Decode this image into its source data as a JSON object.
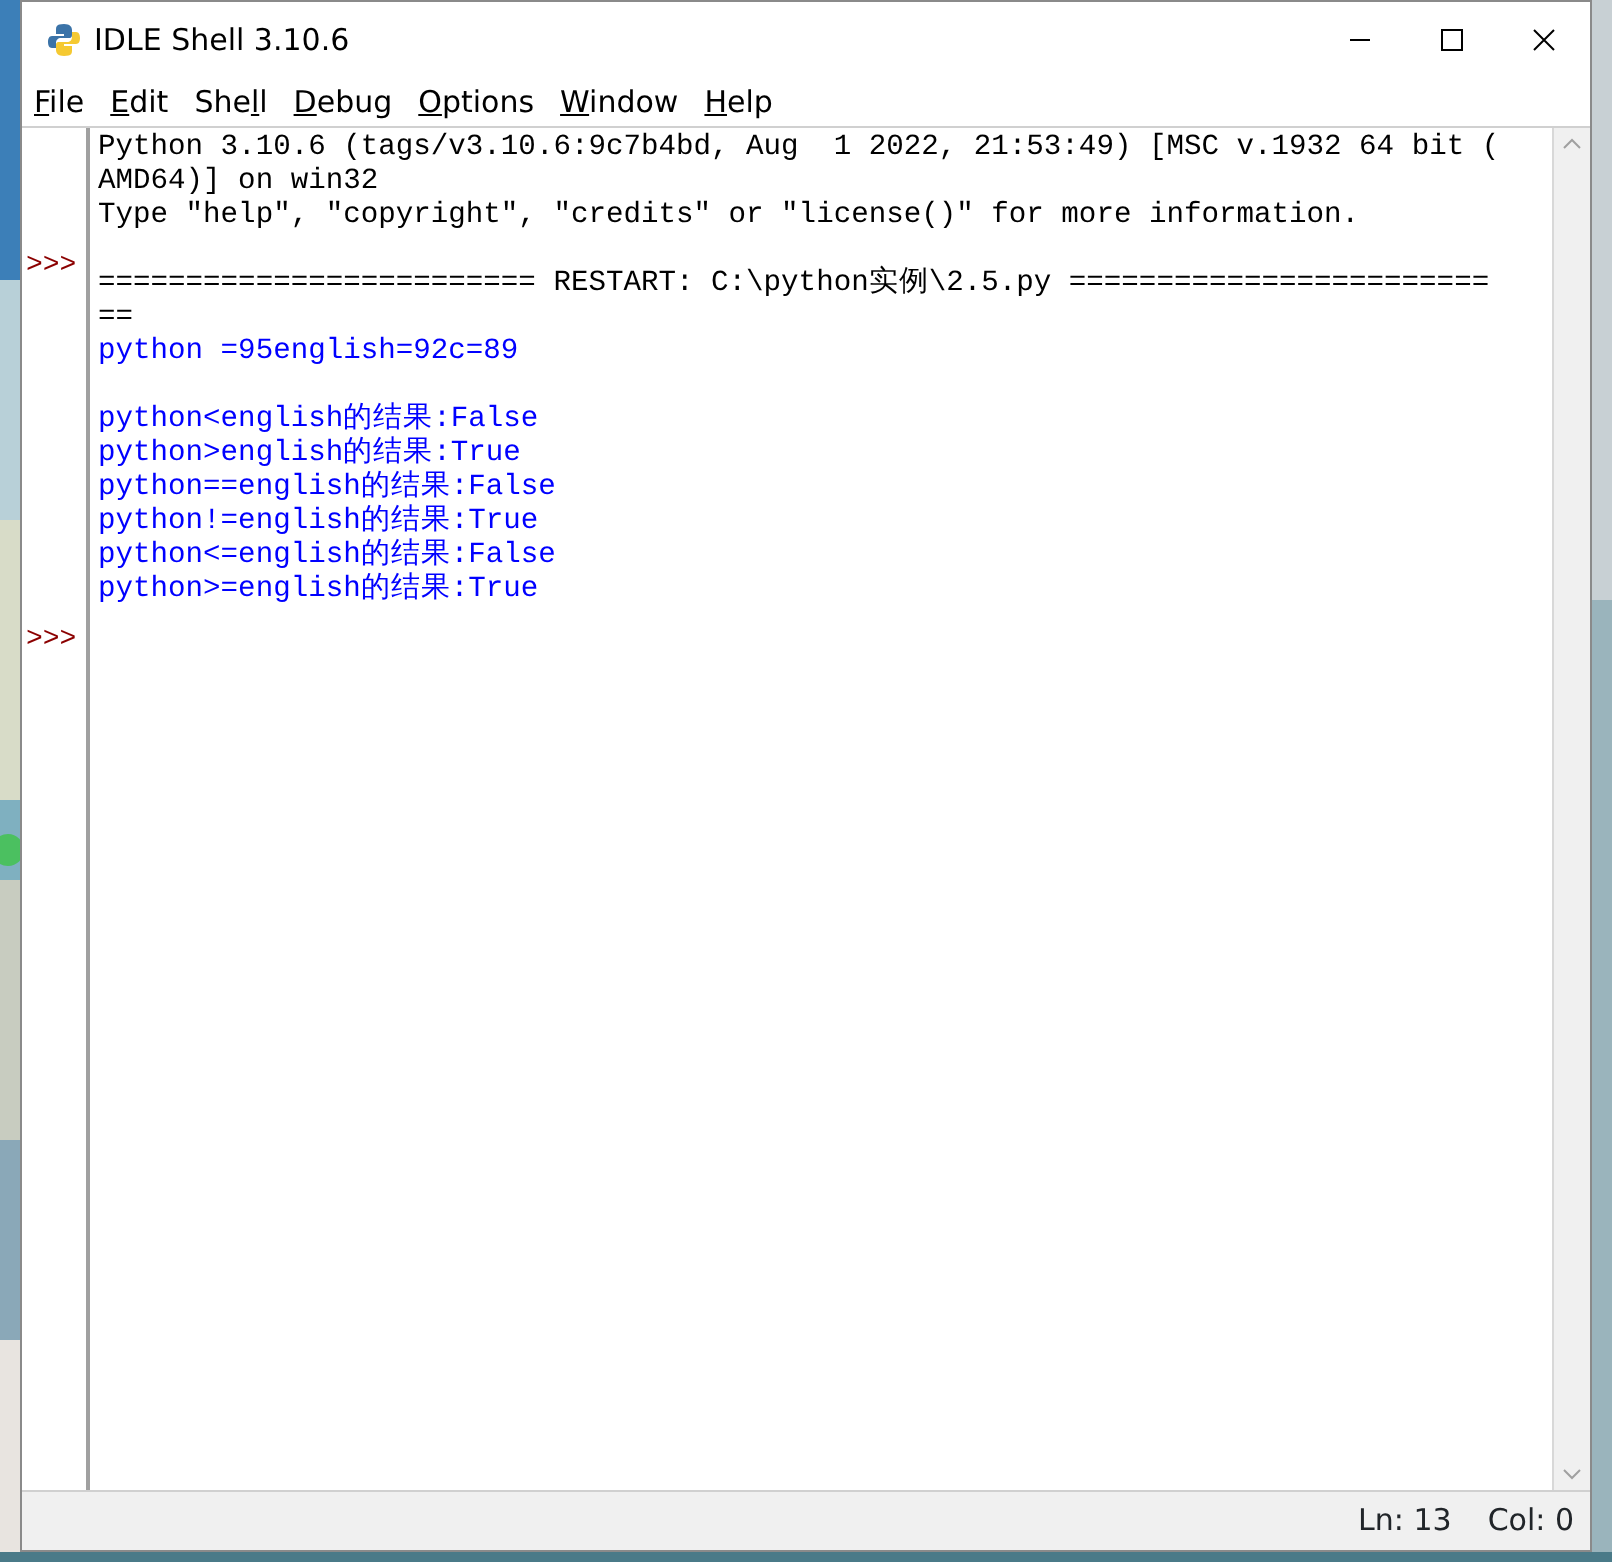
{
  "window": {
    "title": "IDLE Shell 3.10.6"
  },
  "menu": [
    {
      "parts": [
        {
          "text": "F",
          "underlined": true
        },
        {
          "text": "ile",
          "underlined": false
        }
      ]
    },
    {
      "parts": [
        {
          "text": "E",
          "underlined": true
        },
        {
          "text": "dit",
          "underlined": false
        }
      ]
    },
    {
      "parts": [
        {
          "text": "She",
          "underlined": false
        },
        {
          "text": "l",
          "underlined": true
        },
        {
          "text": "l",
          "underlined": false
        }
      ]
    },
    {
      "parts": [
        {
          "text": "D",
          "underlined": true
        },
        {
          "text": "ebug",
          "underlined": false
        }
      ]
    },
    {
      "parts": [
        {
          "text": "O",
          "underlined": true
        },
        {
          "text": "ptions",
          "underlined": false
        }
      ]
    },
    {
      "parts": [
        {
          "text": "W",
          "underlined": true
        },
        {
          "text": "indow",
          "underlined": false
        }
      ]
    },
    {
      "parts": [
        {
          "text": "H",
          "underlined": true
        },
        {
          "text": "elp",
          "underlined": false
        }
      ]
    }
  ],
  "shell": {
    "lines": [
      {
        "kind": "output",
        "text": "Python 3.10.6 (tags/v3.10.6:9c7b4bd, Aug  1 2022, 21:53:49) [MSC v.1932 64 bit ("
      },
      {
        "kind": "output",
        "text": "AMD64)] on win32"
      },
      {
        "kind": "output",
        "text": "Type \"help\", \"copyright\", \"credits\" or \"license()\" for more information."
      },
      {
        "kind": "prompt",
        "prompt": ">>>"
      },
      {
        "kind": "output",
        "text": "========================= RESTART: C:\\python实例\\2.5.py ========================"
      },
      {
        "kind": "output",
        "text": "=="
      },
      {
        "kind": "stdout",
        "text": "python =95english=92c=89"
      },
      {
        "kind": "blank"
      },
      {
        "kind": "stdout",
        "text": "python<english的结果:False"
      },
      {
        "kind": "stdout",
        "text": "python>english的结果:True"
      },
      {
        "kind": "stdout",
        "text": "python==english的结果:False"
      },
      {
        "kind": "stdout",
        "text": "python!=english的结果:True"
      },
      {
        "kind": "stdout",
        "text": "python<=english的结果:False"
      },
      {
        "kind": "stdout",
        "text": "python>=english的结果:True"
      },
      {
        "kind": "prompt",
        "prompt": ">>>"
      }
    ]
  },
  "status_bar": {
    "line": "Ln: 13",
    "column": "Col: 0"
  }
}
